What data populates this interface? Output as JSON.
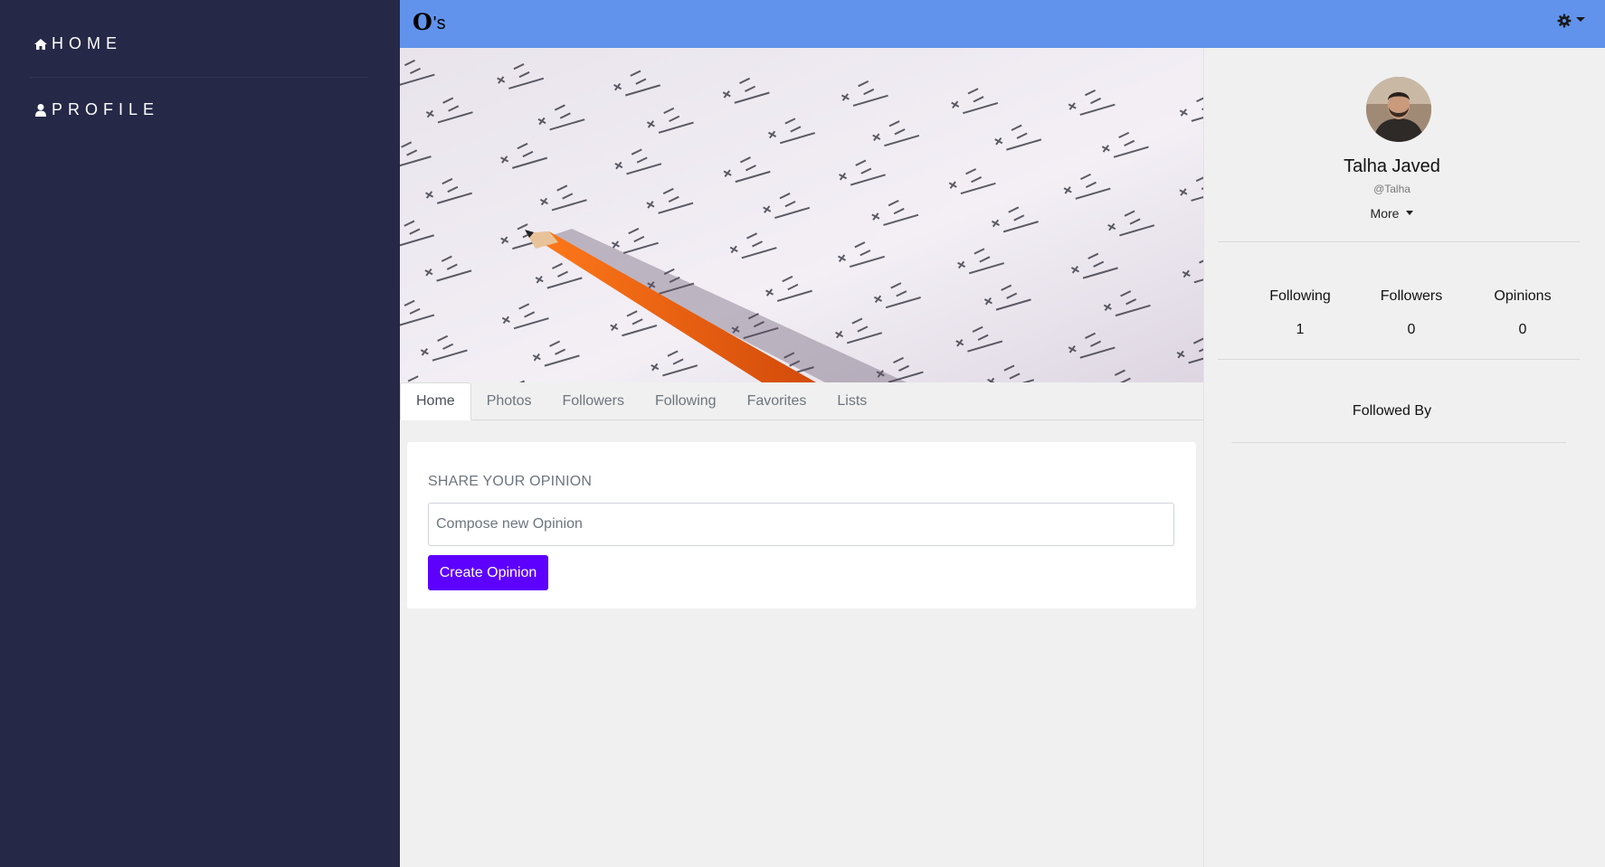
{
  "app": {
    "logo_letter": "O",
    "logo_suffix": "'s"
  },
  "sidebar": {
    "items": [
      {
        "label": "HOME",
        "icon": "home-icon"
      },
      {
        "label": "PROFILE",
        "icon": "user-icon"
      }
    ]
  },
  "topbar": {
    "settings_icon": "gear-icon"
  },
  "tabs": [
    {
      "label": "Home",
      "active": true
    },
    {
      "label": "Photos"
    },
    {
      "label": "Followers"
    },
    {
      "label": "Following"
    },
    {
      "label": "Favorites"
    },
    {
      "label": "Lists"
    }
  ],
  "composer": {
    "title": "SHARE YOUR OPINION",
    "placeholder": "Compose new Opinion",
    "button_label": "Create Opinion"
  },
  "profile": {
    "name": "Talha Javed",
    "handle": "@Talha",
    "more_label": "More",
    "stats": [
      {
        "label": "Following",
        "value": "1"
      },
      {
        "label": "Followers",
        "value": "0"
      },
      {
        "label": "Opinions",
        "value": "0"
      }
    ],
    "followed_by_label": "Followed By"
  },
  "colors": {
    "sidebar_bg": "#252947",
    "topbar_bg": "#6193ec",
    "primary_button": "#5d00ff",
    "page_bg": "#f0f0f0"
  }
}
